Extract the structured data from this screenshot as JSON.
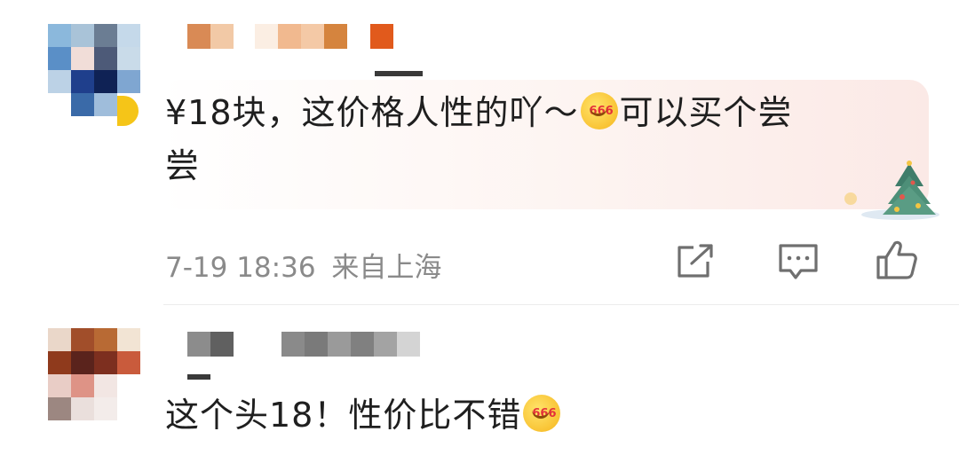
{
  "comments": [
    {
      "text_line1": "¥18块，这价格人性的吖～",
      "text_line1_tail": "可以买个尝",
      "text_line2": "尝",
      "timestamp": "7-19 18:36",
      "location": "来自上海",
      "emoji": {
        "name": "666-emoji",
        "label": "666"
      }
    },
    {
      "text": "这个头18！性价比不错",
      "emoji": {
        "name": "666-emoji",
        "label": "666"
      }
    }
  ],
  "actions": {
    "repost_icon": "repost-icon",
    "comment_icon": "comment-icon",
    "like_icon": "thumbs-up-icon"
  },
  "colors": {
    "text": "#1f1f1f",
    "meta": "#8a8a8a",
    "divider": "#ececec",
    "card_tint": "#fbe9e6"
  }
}
